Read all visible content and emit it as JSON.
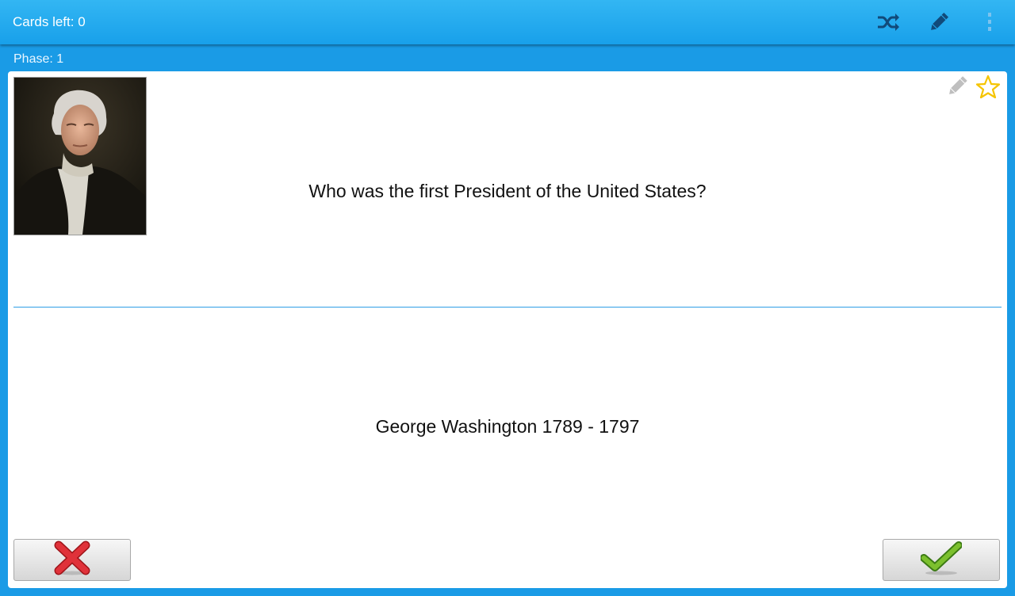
{
  "actionbar": {
    "title": "Cards left: 0",
    "icons": [
      "shuffle-icon",
      "pencil-icon",
      "overflow-menu-icon"
    ]
  },
  "status": {
    "phase": "Phase: 1"
  },
  "card": {
    "image": "portrait-of-george-washington",
    "question": "Who was the first President of the United States?",
    "answer": "George Washington 1789 - 1797",
    "icons": [
      "edit-card-icon",
      "star-icon"
    ]
  },
  "buttons": {
    "wrong_icon": "red-x-icon",
    "right_icon": "green-check-icon"
  },
  "colors": {
    "accent": "#1a9be6",
    "actionbar": "#22a7ee",
    "divider": "#2f9fe6",
    "star": "#f5c400",
    "wrong": "#d9232a",
    "right": "#5aa51c"
  }
}
